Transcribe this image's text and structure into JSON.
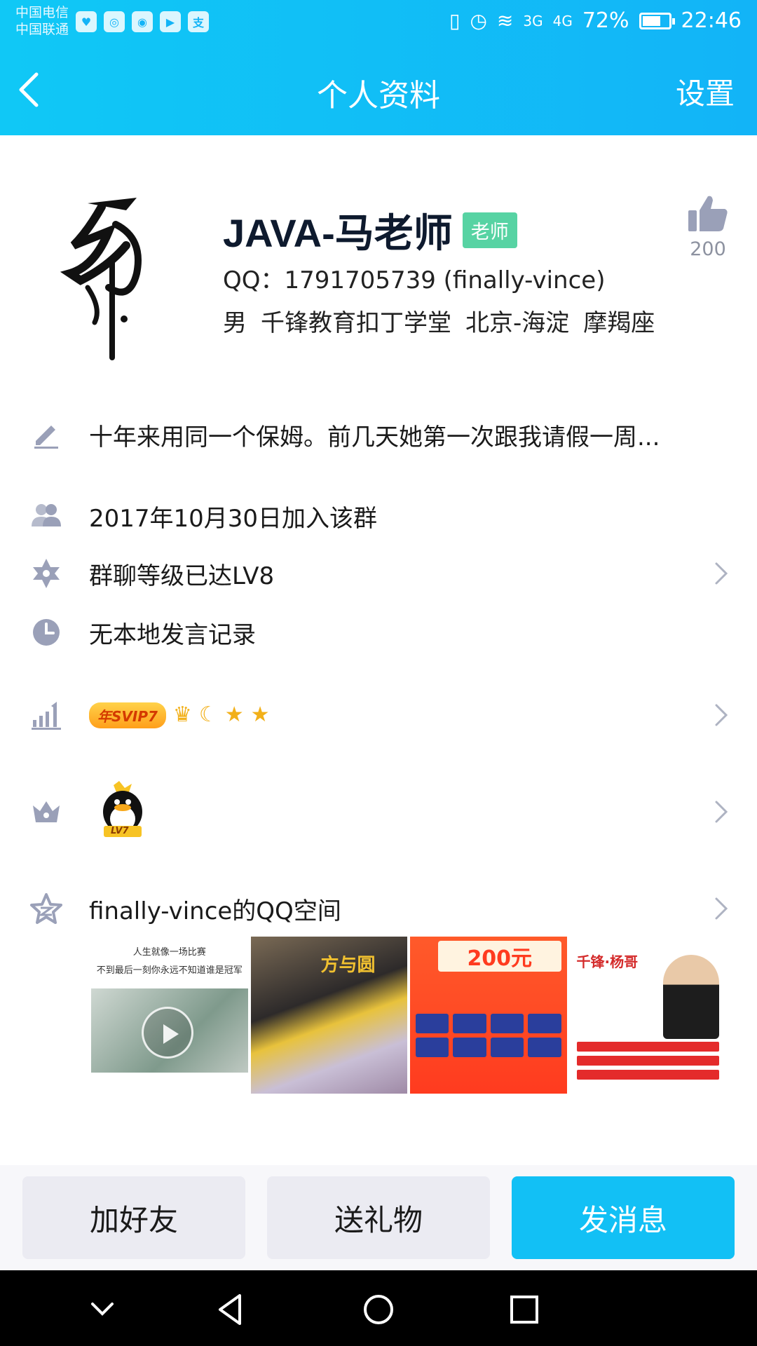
{
  "status_bar": {
    "carrier_1": "中国电信",
    "carrier_2": "中国联通",
    "battery": "72%",
    "battery_level": 0.72,
    "time": "22:46",
    "signal_1": "3G",
    "signal_2": "4G"
  },
  "nav": {
    "title": "个人资料",
    "settings_label": "设置"
  },
  "profile": {
    "name": "JAVA-马老师",
    "badge": "老师",
    "qq_line": "QQ：1791705739 (finally-vince)",
    "gender": "男",
    "school": "千锋教育扣丁学堂",
    "location": "北京-海淀",
    "zodiac": "摩羯座",
    "like_count": "200"
  },
  "rows": {
    "signature": "十年来用同一个保姆。前几天她第一次跟我请假一周...",
    "joined": "2017年10月30日加入该群",
    "group_level": "群聊等级已达LV8",
    "speech": "无本地发言记录",
    "svip_badge": "年SVIP7",
    "qq_level": "LV7",
    "qzone": "finally-vince的QQ空间"
  },
  "qzone_photos": {
    "photo1_line1": "人生就像一场比赛",
    "photo1_line2": "不到最后一刻你永远不知道谁是冠军",
    "photo2_title": "方与圆",
    "photo3_price": "200元",
    "photo4_title": "千锋·杨哥"
  },
  "actions": {
    "add_friend": "加好友",
    "send_gift": "送礼物",
    "send_message": "发消息"
  },
  "colors": {
    "header": "#12b4f7",
    "primary_button": "#12c0f5",
    "badge": "#57d3a3",
    "icon_gray": "#9aa0b8"
  }
}
